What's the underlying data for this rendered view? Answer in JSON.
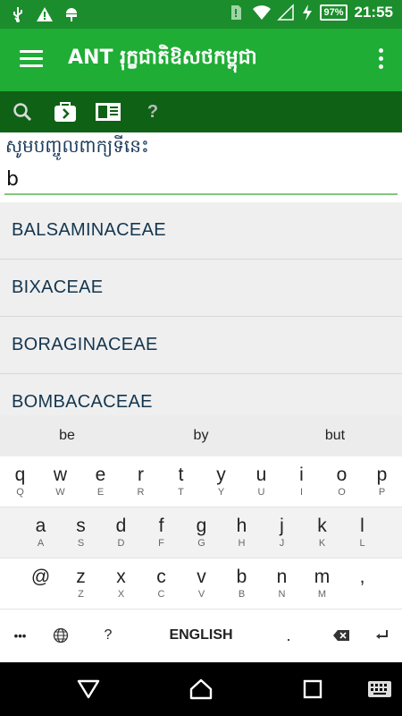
{
  "status_bar": {
    "time": "21:55",
    "battery": "97%",
    "icons": [
      "usb-icon",
      "warning-icon",
      "android-icon",
      "sim-icon",
      "wifi-icon",
      "signal-icon",
      "charging-icon"
    ]
  },
  "app_bar": {
    "title": "ANT រុក្ខជាតិឱសថកម្ពុជា",
    "menu_icon": "hamburger-menu-icon",
    "more_icon": "overflow-menu-icon"
  },
  "toolbar": {
    "buttons": [
      {
        "icon": "search-icon"
      },
      {
        "icon": "forward-folder-icon"
      },
      {
        "icon": "book-icon"
      },
      {
        "icon": "help-icon",
        "label": "?"
      }
    ]
  },
  "search": {
    "prompt": "សូមបញ្ចូលពាក្យទីនេះ",
    "value": "b"
  },
  "results": [
    "BALSAMINACEAE",
    "BIXACEAE",
    "BORAGINACEAE",
    "BOMBACACEAE"
  ],
  "keyboard": {
    "suggestions": [
      "be",
      "by",
      "but"
    ],
    "row1": [
      {
        "k": "q",
        "s": "Q"
      },
      {
        "k": "w",
        "s": "W"
      },
      {
        "k": "e",
        "s": "E"
      },
      {
        "k": "r",
        "s": "R"
      },
      {
        "k": "t",
        "s": "T"
      },
      {
        "k": "y",
        "s": "Y"
      },
      {
        "k": "u",
        "s": "U"
      },
      {
        "k": "i",
        "s": "I"
      },
      {
        "k": "o",
        "s": "O"
      },
      {
        "k": "p",
        "s": "P"
      }
    ],
    "row2": [
      {
        "k": "a",
        "s": "A"
      },
      {
        "k": "s",
        "s": "S"
      },
      {
        "k": "d",
        "s": "D"
      },
      {
        "k": "f",
        "s": "F"
      },
      {
        "k": "g",
        "s": "G"
      },
      {
        "k": "h",
        "s": "H"
      },
      {
        "k": "j",
        "s": "J"
      },
      {
        "k": "k",
        "s": "K"
      },
      {
        "k": "l",
        "s": "L"
      }
    ],
    "row3": [
      {
        "k": "@",
        "s": ""
      },
      {
        "k": "z",
        "s": "Z"
      },
      {
        "k": "x",
        "s": "X"
      },
      {
        "k": "c",
        "s": "C"
      },
      {
        "k": "v",
        "s": "V"
      },
      {
        "k": "b",
        "s": "B"
      },
      {
        "k": "n",
        "s": "N"
      },
      {
        "k": "m",
        "s": "M"
      },
      {
        "k": ",",
        "s": ""
      }
    ],
    "bottom": {
      "more": "•••",
      "question": "?",
      "space": "ENGLISH",
      "period": "."
    }
  },
  "nav_bar": {
    "back_icon": "back-triangle-icon",
    "home_icon": "home-icon",
    "recents_icon": "recents-square-icon",
    "keyboard_icon": "keyboard-icon"
  },
  "colors": {
    "status_bar": "#1b8d2c",
    "app_bar": "#1fad35",
    "toolbar": "#0f6116",
    "result_text": "#14364f",
    "input_underline": "#82c77f"
  }
}
